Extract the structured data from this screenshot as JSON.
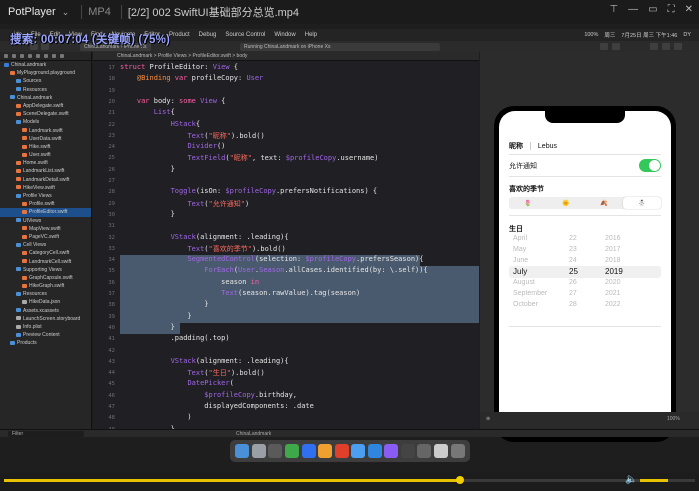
{
  "potplayer": {
    "app_name": "PotPlayer",
    "format": "MP4",
    "title": "[2/2] 002 SwiftUI基础部分总览.mp4",
    "progress": 0.66,
    "volume": 0.55
  },
  "overlay": {
    "search_text": "搜索: 00:07:04 (关键帧) (75%)"
  },
  "mac_menu": {
    "items": [
      "ide",
      "File",
      "Edit",
      "View",
      "Find",
      "Navigate",
      "Editor",
      "Product",
      "Debug",
      "Source Control",
      "Window",
      "Help"
    ],
    "right": [
      "100%",
      "周三",
      "7月25日 周三 下午1:46",
      "DY"
    ]
  },
  "xcode": {
    "scheme": "ChinaLandmark",
    "device": "iPhone Xs",
    "status": "Running ChinaLandmark on iPhone Xs",
    "jumpbar": "ChinaLandmark > Profile Views > ProfileEditor.swift > body",
    "debug_target": "ChinaLandmark",
    "filter_placeholder": "Filter",
    "zoom": "100%"
  },
  "navigator": [
    {
      "label": "ChinaLandmark",
      "icon": "proj",
      "indent": 0
    },
    {
      "label": "MyPlayground.playground",
      "icon": "swift",
      "indent": 1
    },
    {
      "label": "Sources",
      "icon": "folder",
      "indent": 2
    },
    {
      "label": "Resources",
      "icon": "folder",
      "indent": 2
    },
    {
      "label": "ChinaLandmark",
      "icon": "folder",
      "indent": 1
    },
    {
      "label": "AppDelegate.swift",
      "icon": "swift",
      "indent": 2
    },
    {
      "label": "SceneDelegate.swift",
      "icon": "swift",
      "indent": 2
    },
    {
      "label": "Models",
      "icon": "folder",
      "indent": 2
    },
    {
      "label": "Landmark.swift",
      "icon": "swift",
      "indent": 3
    },
    {
      "label": "UserData.swift",
      "icon": "swift",
      "indent": 3
    },
    {
      "label": "Hike.swift",
      "icon": "swift",
      "indent": 3
    },
    {
      "label": "User.swift",
      "icon": "swift",
      "indent": 3
    },
    {
      "label": "Home.swift",
      "icon": "swift",
      "indent": 2
    },
    {
      "label": "LandmarkList.swift",
      "icon": "swift",
      "indent": 2
    },
    {
      "label": "LandmarkDetail.swift",
      "icon": "swift",
      "indent": 2
    },
    {
      "label": "HikeView.swift",
      "icon": "swift",
      "indent": 2
    },
    {
      "label": "Profile Views",
      "icon": "folder",
      "indent": 2
    },
    {
      "label": "Profile.swift",
      "icon": "swift",
      "indent": 3
    },
    {
      "label": "ProfileEditor.swift",
      "icon": "swift",
      "indent": 3,
      "selected": true
    },
    {
      "label": "UIViews",
      "icon": "folder",
      "indent": 2
    },
    {
      "label": "MapView.swift",
      "icon": "swift",
      "indent": 3
    },
    {
      "label": "PageVC.swift",
      "icon": "swift",
      "indent": 3
    },
    {
      "label": "Cell Views",
      "icon": "folder",
      "indent": 2
    },
    {
      "label": "CategoryCell.swift",
      "icon": "swift",
      "indent": 3
    },
    {
      "label": "LandmarkCell.swift",
      "icon": "swift",
      "indent": 3
    },
    {
      "label": "Supporting Views",
      "icon": "folder",
      "indent": 2
    },
    {
      "label": "GraphCapsule.swift",
      "icon": "swift",
      "indent": 3
    },
    {
      "label": "HikeGraph.swift",
      "icon": "swift",
      "indent": 3
    },
    {
      "label": "Resources",
      "icon": "folder",
      "indent": 2
    },
    {
      "label": "HikeData.json",
      "icon": "plist",
      "indent": 3
    },
    {
      "label": "Assets.xcassets",
      "icon": "folder",
      "indent": 2
    },
    {
      "label": "LaunchScreen.storyboard",
      "icon": "plist",
      "indent": 2
    },
    {
      "label": "Info.plist",
      "icon": "plist",
      "indent": 2
    },
    {
      "label": "Preview Content",
      "icon": "folder",
      "indent": 2
    },
    {
      "label": "Products",
      "icon": "folder",
      "indent": 1
    }
  ],
  "code": [
    {
      "n": 17,
      "html": "<span class=\"kw\">struct</span> ProfileEditor: <span class=\"ty\">View</span> {"
    },
    {
      "n": 18,
      "html": "    <span class=\"at\">@Binding</span> <span class=\"kw\">var</span> profileCopy: <span class=\"ty\">User</span>"
    },
    {
      "n": 19,
      "html": ""
    },
    {
      "n": 20,
      "html": "    <span class=\"kw\">var</span> body: <span class=\"kw\">some</span> <span class=\"ty\">View</span> {"
    },
    {
      "n": 21,
      "html": "        <span class=\"ty\">List</span>{"
    },
    {
      "n": 22,
      "html": "            <span class=\"ty\">HStack</span>{"
    },
    {
      "n": 23,
      "html": "                <span class=\"ty\">Text</span>(<span class=\"str\">\"昵称\"</span>).bold()"
    },
    {
      "n": 24,
      "html": "                <span class=\"ty\">Divider</span>()"
    },
    {
      "n": 25,
      "html": "                <span class=\"ty\">TextField</span>(<span class=\"str\">\"昵称\"</span>, text: <span class=\"ty\">$profileCopy</span>.username)"
    },
    {
      "n": 26,
      "html": "            }"
    },
    {
      "n": 27,
      "html": ""
    },
    {
      "n": 28,
      "html": "            <span class=\"ty\">Toggle</span>(isOn: <span class=\"ty\">$profileCopy</span>.prefersNotifications) {"
    },
    {
      "n": 29,
      "html": "                <span class=\"ty\">Text</span>(<span class=\"str\">\"允许通知\"</span>)"
    },
    {
      "n": 30,
      "html": "            }"
    },
    {
      "n": 31,
      "html": ""
    },
    {
      "n": 32,
      "html": "            <span class=\"ty\">VStack</span>(alignment: .leading){"
    },
    {
      "n": 33,
      "html": "                <span class=\"ty\">Text</span>(<span class=\"str\">\"喜欢的季节\"</span>).bold()"
    },
    {
      "n": 34,
      "html": "                <span class=\"ty\">SegmentedControl</span>(selection: <span class=\"ty\">$profileCopy</span>.prefersSeason){",
      "sel": [
        0,
        300
      ]
    },
    {
      "n": 35,
      "html": "                    <span class=\"ty\">ForEach</span>(<span class=\"ty\">User</span>.<span class=\"ty\">Season</span>.allCases.identified(by: \\.self)){",
      "sel": [
        0,
        386
      ]
    },
    {
      "n": 36,
      "html": "                        season <span class=\"kw\">in</span>",
      "sel": [
        0,
        386
      ]
    },
    {
      "n": 37,
      "html": "                        <span class=\"ty\">Text</span>(season.rawValue).tag(season)",
      "sel": [
        0,
        386
      ]
    },
    {
      "n": 38,
      "html": "                    }",
      "sel": [
        0,
        386
      ]
    },
    {
      "n": 39,
      "html": "                }",
      "sel": [
        0,
        386
      ]
    },
    {
      "n": 40,
      "html": "            }",
      "sel": [
        0,
        60
      ]
    },
    {
      "n": 41,
      "html": "            .padding(.top)"
    },
    {
      "n": 42,
      "html": ""
    },
    {
      "n": 43,
      "html": "            <span class=\"ty\">VStack</span>(alignment: .leading){"
    },
    {
      "n": 44,
      "html": "                <span class=\"ty\">Text</span>(<span class=\"str\">\"生日\"</span>).bold()"
    },
    {
      "n": 45,
      "html": "                <span class=\"ty\">DatePicker</span>("
    },
    {
      "n": 46,
      "html": "                    <span class=\"ty\">$profileCopy</span>.birthday,"
    },
    {
      "n": 47,
      "html": "                    displayedComponents: .date"
    },
    {
      "n": 48,
      "html": "                )"
    },
    {
      "n": 49,
      "html": "            }"
    },
    {
      "n": 50,
      "html": "            .padding(.top)"
    },
    {
      "n": 51,
      "html": "        }"
    },
    {
      "n": 52,
      "html": "    }"
    },
    {
      "n": 53,
      "html": ""
    }
  ],
  "preview": {
    "nickname_label": "昵称",
    "nickname_value": "Lebus",
    "notify_label": "允许通知",
    "season_label": "喜欢的季节",
    "seasons": [
      "🌷",
      "🌞",
      "🍂",
      "☃️"
    ],
    "season_selected": 3,
    "birthday_label": "生日",
    "picker_months": [
      "April",
      "May",
      "June",
      "July",
      "August",
      "September",
      "October"
    ],
    "picker_days": [
      "22",
      "23",
      "24",
      "25",
      "26",
      "27",
      "28"
    ],
    "picker_years": [
      "2016",
      "2017",
      "2018",
      "2019",
      "2020",
      "2021",
      "2022"
    ],
    "picker_current_index": 3
  },
  "dock_colors": [
    "#4a90d9",
    "#9aa0a6",
    "#5a5a5a",
    "#3ea84a",
    "#2f6ff0",
    "#f0a030",
    "#e0402a",
    "#4b9ef0",
    "#2e86de",
    "#8a5cf6",
    "#444",
    "#666",
    "#ccc",
    "#777"
  ]
}
